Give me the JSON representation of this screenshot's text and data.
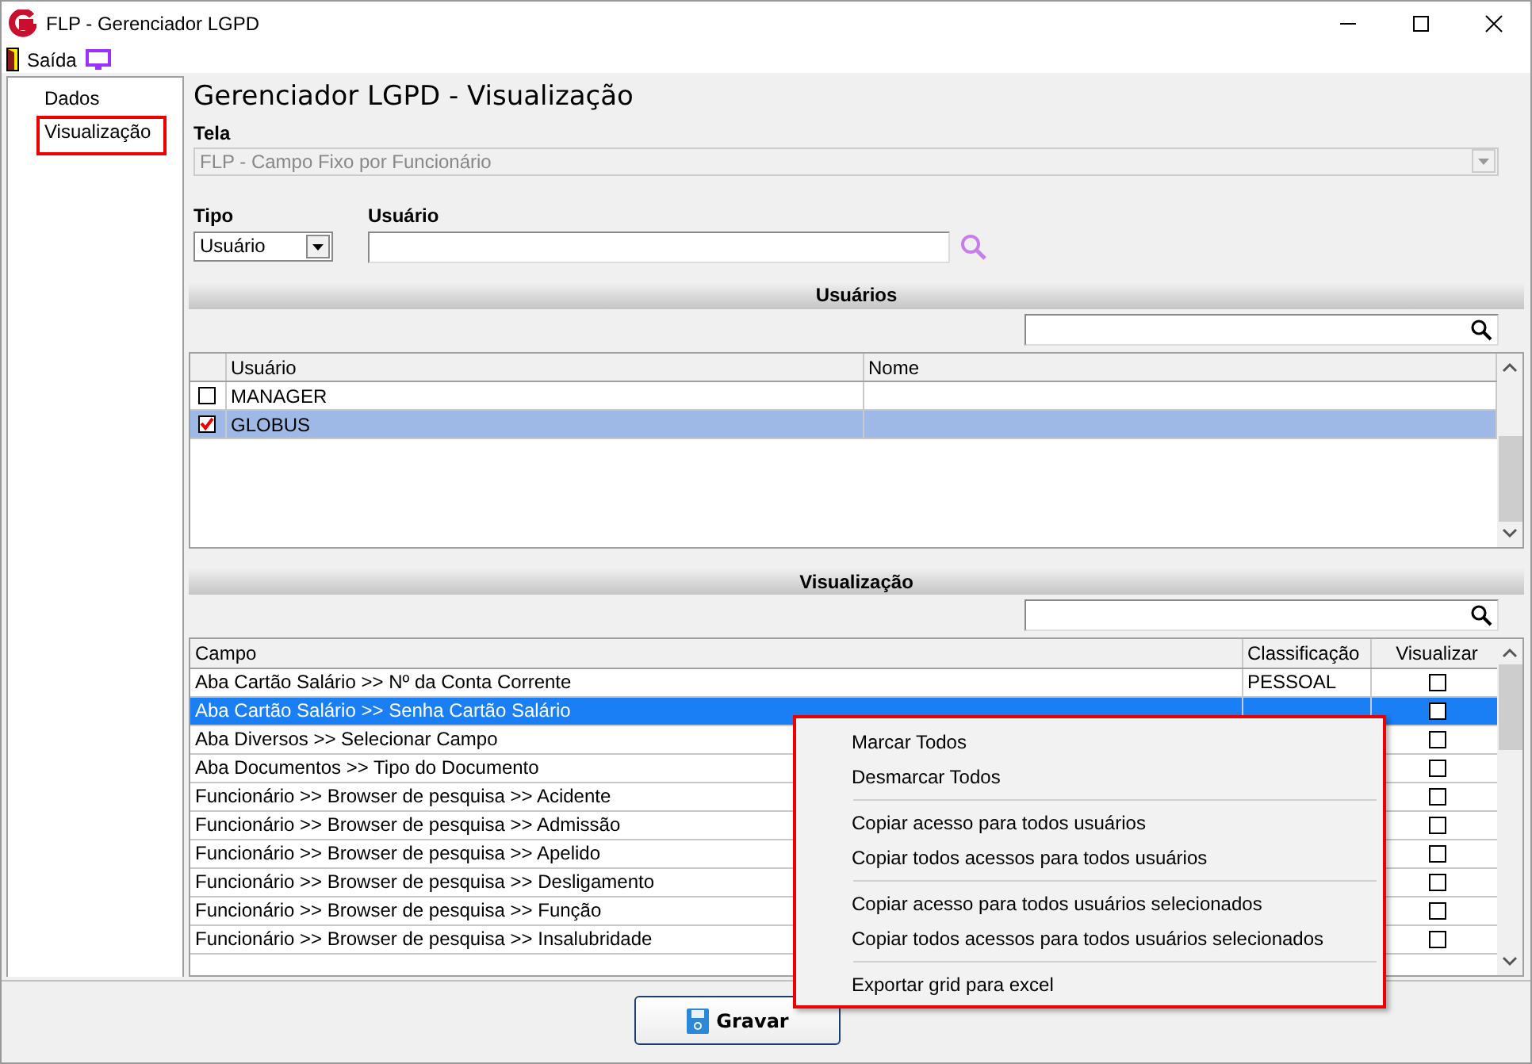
{
  "window": {
    "title": "FLP - Gerenciador LGPD"
  },
  "toolbar": {
    "exit_label": "Saída"
  },
  "sidebar": {
    "items": [
      {
        "label": "Dados",
        "selected": false
      },
      {
        "label": "Visualização",
        "selected": true
      }
    ]
  },
  "page_title": "Gerenciador LGPD - Visualização",
  "tela": {
    "label": "Tela",
    "value": "FLP - Campo Fixo por Funcionário",
    "disabled": true
  },
  "tipo": {
    "label": "Tipo",
    "value": "Usuário"
  },
  "usuario": {
    "label": "Usuário"
  },
  "users_section": {
    "title": "Usuários",
    "columns": [
      "Usuário",
      "Nome"
    ],
    "rows": [
      {
        "usuario": "MANAGER",
        "checked": false,
        "selected": false
      },
      {
        "usuario": "GLOBUS",
        "checked": true,
        "selected": true
      }
    ]
  },
  "view_section": {
    "title": "Visualização",
    "columns": [
      "Campo",
      "Classificação",
      "Visualizar"
    ],
    "rows": [
      {
        "campo": "Aba Cartão Salário >> Nº da Conta Corrente",
        "classificacao": "PESSOAL",
        "visualizar": false,
        "selected": false
      },
      {
        "campo": "Aba Cartão Salário >> Senha Cartão Salário",
        "visualizar": false,
        "selected": true
      },
      {
        "campo": "Aba Diversos >> Selecionar Campo",
        "visualizar": false,
        "selected": false
      },
      {
        "campo": "Aba Documentos >> Tipo do Documento",
        "visualizar": false,
        "selected": false
      },
      {
        "campo": "Funcionário >> Browser de pesquisa >> Acidente",
        "visualizar": false,
        "selected": false
      },
      {
        "campo": "Funcionário >> Browser de pesquisa >> Admissão",
        "visualizar": false,
        "selected": false
      },
      {
        "campo": "Funcionário >> Browser de pesquisa >> Apelido",
        "visualizar": false,
        "selected": false
      },
      {
        "campo": "Funcionário >> Browser de pesquisa >> Desligamento",
        "visualizar": false,
        "selected": false
      },
      {
        "campo": "Funcionário >> Browser de pesquisa >> Função",
        "visualizar": false,
        "selected": false
      },
      {
        "campo": "Funcionário >> Browser de pesquisa >> Insalubridade",
        "visualizar": false,
        "selected": false
      }
    ]
  },
  "context_menu": {
    "groups": [
      [
        "Marcar Todos",
        "Desmarcar Todos"
      ],
      [
        "Copiar acesso para todos usuários",
        "Copiar todos acessos para todos usuários"
      ],
      [
        "Copiar acesso para todos usuários selecionados",
        "Copiar todos acessos para todos usuários selecionados"
      ],
      [
        "Exportar grid para excel"
      ]
    ]
  },
  "save_button": {
    "label": "Gravar"
  }
}
